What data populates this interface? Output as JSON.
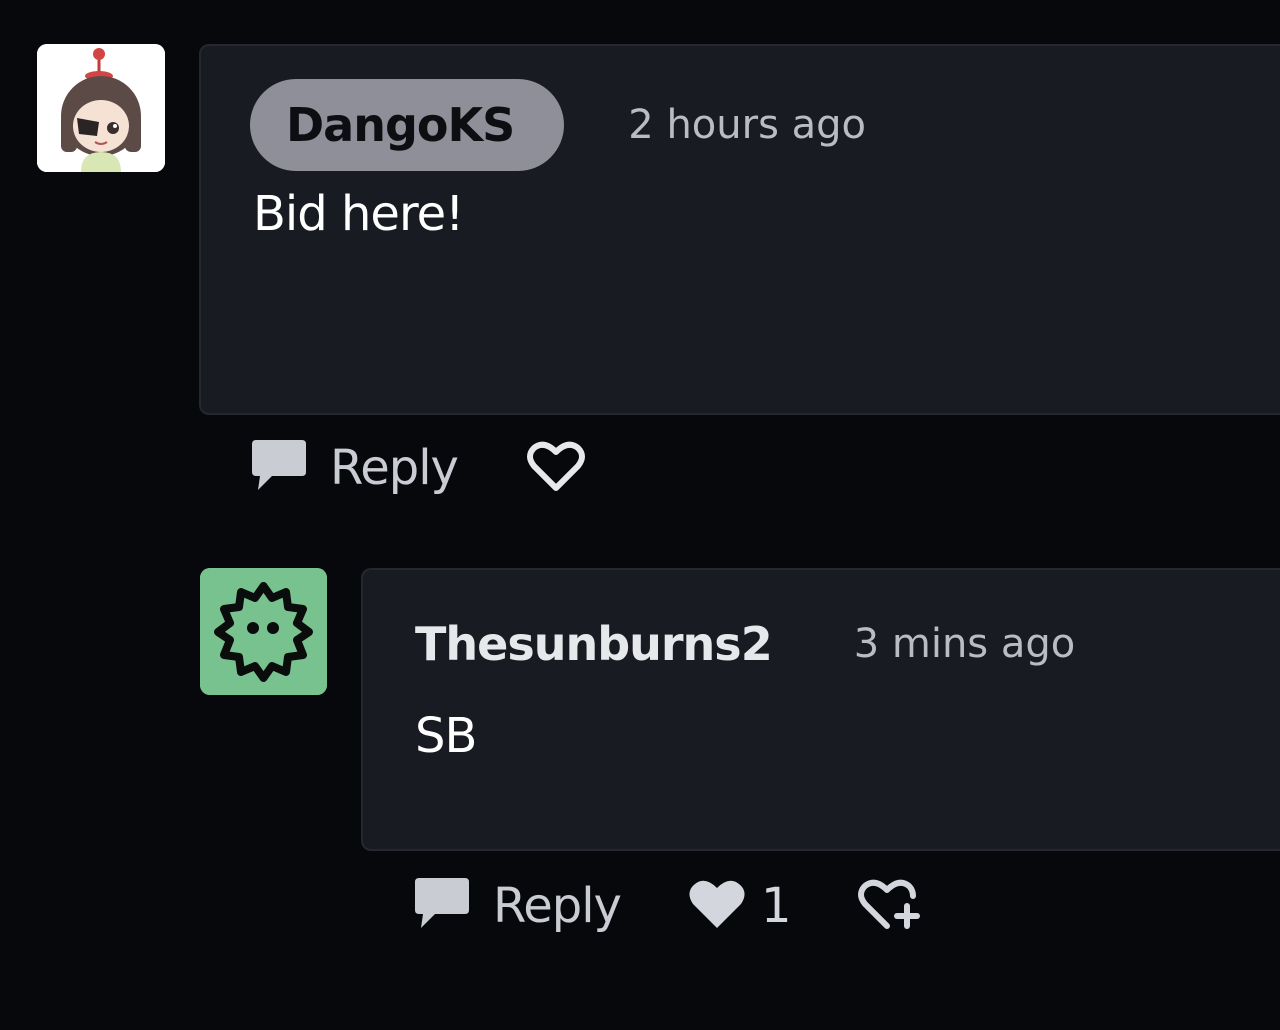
{
  "comments": [
    {
      "author": "DangoKS",
      "timestamp": "2 hours ago",
      "body": "Bid here!",
      "reply_label": "Reply",
      "avatar_icon": "anime-girl-avatar",
      "liked": false
    },
    {
      "author": "Thesunburns2",
      "timestamp": "3 mins ago",
      "body": "SB",
      "reply_label": "Reply",
      "like_count": "1",
      "avatar_icon": "green-spiky-face-avatar",
      "liked": true
    }
  ],
  "colors": {
    "background": "#07080c",
    "card": "#181b21",
    "pill": "#8e8f99",
    "avatar_green": "#77c28e"
  }
}
